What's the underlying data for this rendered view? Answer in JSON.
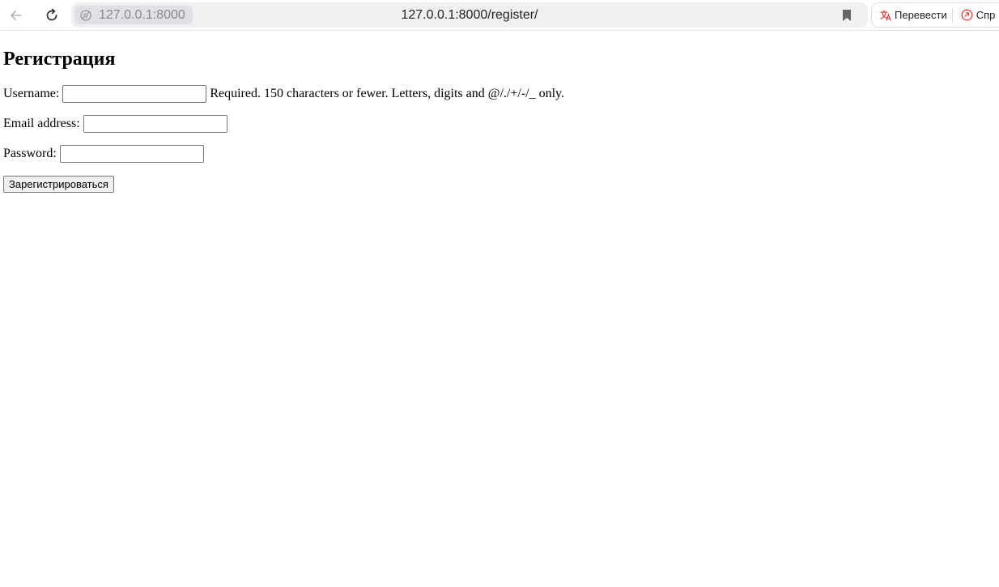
{
  "browser": {
    "site_chip": "127.0.0.1:8000",
    "url": "127.0.0.1:8000/register/",
    "translate_label": "Перевести",
    "ask_label": "Спр",
    "icons": {
      "back": "back-arrow-icon",
      "reload": "reload-icon",
      "connection": "no-connection-icon",
      "bookmark": "bookmark-icon",
      "translate": "translate-icon",
      "ask": "ask-icon"
    }
  },
  "page": {
    "title": "Регистрация",
    "fields": {
      "username": {
        "label": "Username:",
        "value": "",
        "help": "Required. 150 characters or fewer. Letters, digits and @/./+/-/_ only."
      },
      "email": {
        "label": "Email address:",
        "value": ""
      },
      "password": {
        "label": "Password:",
        "value": ""
      }
    },
    "submit_label": "Зарегистрироваться"
  },
  "colors": {
    "omnibox_bg": "#f0f0f2",
    "chip_bg": "#e1e1e5",
    "translate_accent": "#e8413a"
  }
}
